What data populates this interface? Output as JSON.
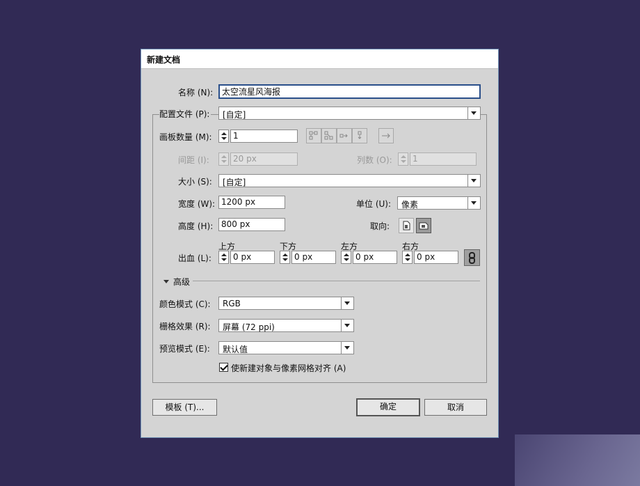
{
  "dialog": {
    "title": "新建文档",
    "name_label": "名称 (N):",
    "name_value": "太空流星风海报",
    "profile_label": "配置文件 (P):",
    "profile_value": "[自定]",
    "artboards_label": "画板数量 (M):",
    "artboards_value": "1",
    "spacing_label": "间距 (I):",
    "spacing_value": "20 px",
    "columns_label": "列数 (O):",
    "columns_value": "1",
    "size_label": "大小 (S):",
    "size_value": "[自定]",
    "width_label": "宽度 (W):",
    "width_value": "1200 px",
    "units_label": "单位 (U):",
    "units_value": "像素",
    "height_label": "高度 (H):",
    "height_value": "800 px",
    "orientation_label": "取向:",
    "bleed_label": "出血 (L):",
    "bleed": {
      "top_label": "上方",
      "top_value": "0 px",
      "bottom_label": "下方",
      "bottom_value": "0 px",
      "left_label": "左方",
      "left_value": "0 px",
      "right_label": "右方",
      "right_value": "0 px"
    },
    "advanced_label": "高级",
    "color_mode_label": "颜色模式 (C):",
    "color_mode_value": "RGB",
    "raster_label": "栅格效果 (R):",
    "raster_value": "屏幕 (72 ppi)",
    "preview_label": "预览模式 (E):",
    "preview_value": "默认值",
    "align_checkbox_label": "使新建对象与像素网格对齐 (A)",
    "align_checked": true,
    "templates_button": "模板 (T)...",
    "ok_button": "确定",
    "cancel_button": "取消"
  },
  "icons": [
    "grid-by-row-icon",
    "grid-by-column-icon",
    "arrange-by-row-icon",
    "arrange-by-column-icon",
    "right-to-left-icon",
    "portrait-icon",
    "landscape-icon",
    "link-chain-icon"
  ]
}
